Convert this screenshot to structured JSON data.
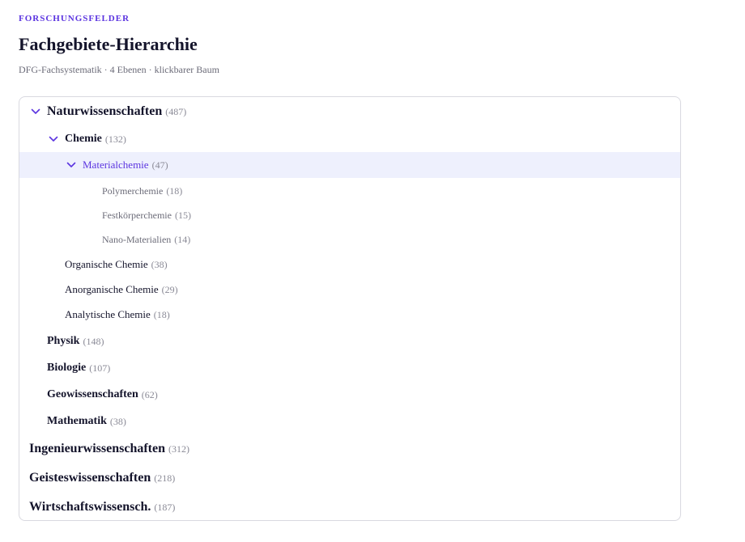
{
  "header": {
    "eyebrow": "FORSCHUNGSFELDER",
    "title": "Fachgebiete-Hierarchie",
    "subtitle": "DFG-Fachsystematik · 4 Ebenen · klickbarer Baum"
  },
  "colors": {
    "accent": "#5b34e0",
    "selected_bg": "#eef0fd",
    "border": "#d9d9e0",
    "muted": "#8a8a96"
  },
  "tree": {
    "nodes": [
      {
        "id": "naturwissenschaften",
        "label": "Naturwissenschaften",
        "count": "(487)",
        "level": 1,
        "expanded": true
      },
      {
        "id": "chemie",
        "label": "Chemie",
        "count": "(132)",
        "level": 2,
        "expanded": true
      },
      {
        "id": "materialchemie",
        "label": "Materialchemie",
        "count": "(47)",
        "level": 3,
        "expanded": true,
        "selected": true
      },
      {
        "id": "polymerchemie",
        "label": "Polymerchemie",
        "count": "(18)",
        "level": 4
      },
      {
        "id": "festkoerperchemie",
        "label": "Festkörperchemie",
        "count": "(15)",
        "level": 4
      },
      {
        "id": "nano-materialien",
        "label": "Nano-Materialien",
        "count": "(14)",
        "level": 4
      },
      {
        "id": "organische-chemie",
        "label": "Organische Chemie",
        "count": "(38)",
        "level": 3
      },
      {
        "id": "anorganische-chemie",
        "label": "Anorganische Chemie",
        "count": "(29)",
        "level": 3
      },
      {
        "id": "analytische-chemie",
        "label": "Analytische Chemie",
        "count": "(18)",
        "level": 3
      },
      {
        "id": "physik",
        "label": "Physik",
        "count": "(148)",
        "level": 2
      },
      {
        "id": "biologie",
        "label": "Biologie",
        "count": "(107)",
        "level": 2
      },
      {
        "id": "geowissenschaften",
        "label": "Geowissenschaften",
        "count": "(62)",
        "level": 2
      },
      {
        "id": "mathematik",
        "label": "Mathematik",
        "count": "(38)",
        "level": 2
      },
      {
        "id": "ingenieurwissenschaften",
        "label": "Ingenieurwissenschaften",
        "count": "(312)",
        "level": 1
      },
      {
        "id": "geisteswissenschaften",
        "label": "Geisteswissenschaften",
        "count": "(218)",
        "level": 1
      },
      {
        "id": "wirtschaftswissensch",
        "label": "Wirtschaftswissensch.",
        "count": "(187)",
        "level": 1
      }
    ]
  }
}
